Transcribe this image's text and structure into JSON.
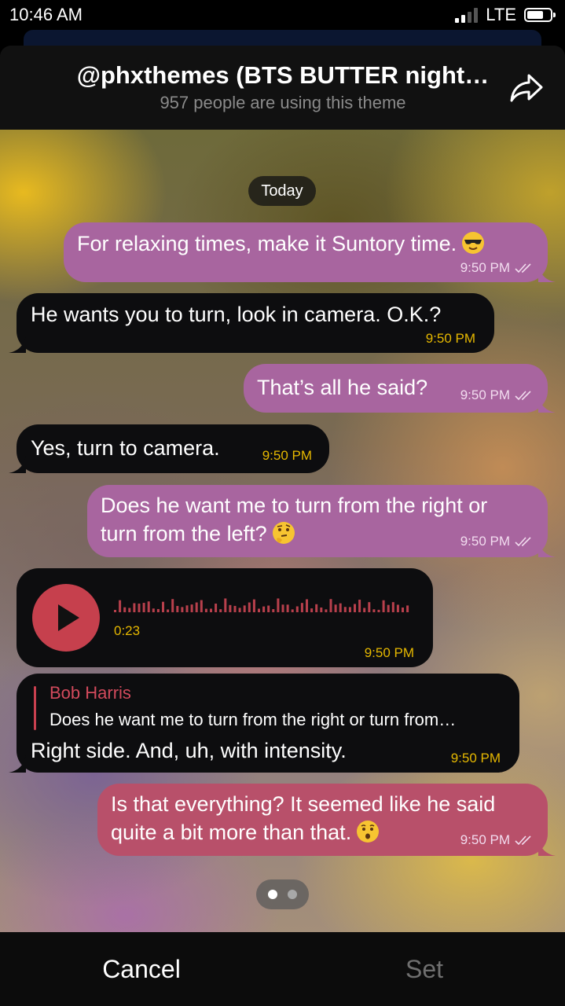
{
  "status_bar": {
    "time": "10:46 AM",
    "network": "LTE"
  },
  "header": {
    "title": "@phxthemes (BTS BUTTER night…",
    "subtitle": "957 people are using this theme",
    "share_icon": "share-arrow-icon"
  },
  "chat": {
    "date_label": "Today",
    "messages": [
      {
        "text": "For relaxing times, make it Suntory time.",
        "time": "9:50 PM",
        "emoji": "sunglasses-face-emoji"
      },
      {
        "text": "He wants you to turn, look in camera. O.K.?",
        "time": "9:50 PM"
      },
      {
        "text": "That’s all he said?",
        "time": "9:50 PM"
      },
      {
        "text": "Yes, turn to camera.",
        "time": "9:50 PM"
      },
      {
        "line1": "Does he want me to turn from the right or",
        "line2": "turn from the left?",
        "time": "9:50 PM",
        "emoji": "thinking-face-emoji"
      },
      {
        "voice_duration": "0:23",
        "time": "9:50 PM",
        "play_icon": "play-icon"
      },
      {
        "reply_name": "Bob Harris",
        "reply_text": "Does he want me to turn from the right or turn from…",
        "text": "Right side. And, uh, with intensity.",
        "time": "9:50 PM"
      },
      {
        "line1": "Is that everything? It seemed like he said",
        "line2": "quite a bit more than that.",
        "time": "9:50 PM",
        "emoji": "hushed-face-emoji"
      }
    ],
    "pager": {
      "page_count": 2,
      "active_index": 0
    }
  },
  "bottom_bar": {
    "cancel_label": "Cancel",
    "set_label": "Set"
  },
  "colors": {
    "outgoing_bubble": "#a8659f",
    "outgoing_bubble_last": "#b8506a",
    "incoming_bubble": "#0d0d0f",
    "incoming_time": "#e6b800",
    "reply_accent": "#d24a5c",
    "play_button": "#c6404d"
  }
}
